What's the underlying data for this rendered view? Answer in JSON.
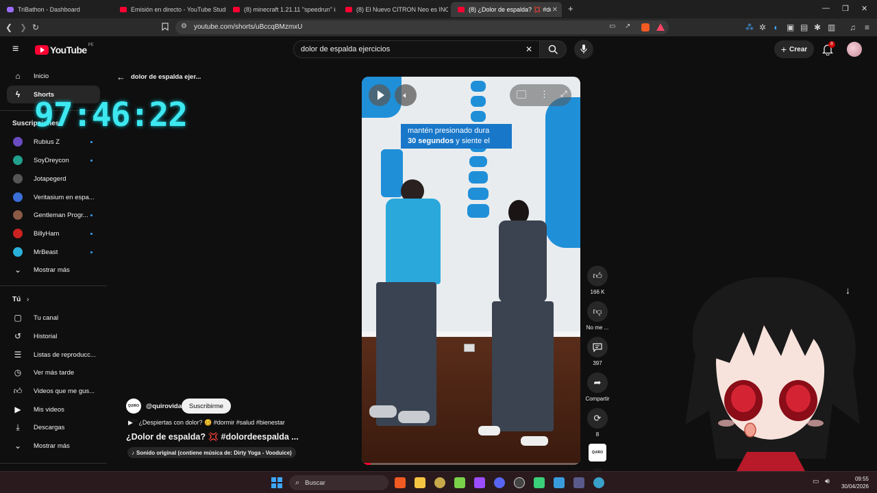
{
  "browser": {
    "tabs": [
      {
        "title": "TriBathon - Dashboard"
      },
      {
        "title": "Emisión en directo - YouTube Studio"
      },
      {
        "title": "(8) minecraft 1.21.11 \"speedrun\" in 2..."
      },
      {
        "title": "(8) El Nuevo CITRON Neo es INCREÍB..."
      },
      {
        "title": "(8) ¿Dolor de espalda? 💢 #dolo..."
      }
    ],
    "url": "youtube.com/shorts/uBccqBMzmxU"
  },
  "yt": {
    "logo_text": "YouTube",
    "logo_region": "PE",
    "search_value": "dolor de espalda ejercicios",
    "create_label": "Crear",
    "notif_count": "8"
  },
  "sidebar": {
    "main": [
      {
        "label": "Inicio",
        "icon": "home-icon"
      },
      {
        "label": "Shorts",
        "icon": "shorts-icon"
      }
    ],
    "subs_header": "Suscripciones",
    "subs": [
      {
        "label": "Rubius Z",
        "color": "#6a4cc2",
        "dot": true
      },
      {
        "label": "SoyDreycon",
        "color": "#21a08c",
        "dot": true
      },
      {
        "label": "Jotapegerd",
        "color": "#555555",
        "dot": false
      },
      {
        "label": "Veritasium en espa...",
        "color": "#3a6fd8",
        "dot": false
      },
      {
        "label": "Gentleman Progr...",
        "color": "#8a5a44",
        "dot": true
      },
      {
        "label": "BillyHam",
        "color": "#cc2222",
        "dot": true
      },
      {
        "label": "MrBeast",
        "color": "#2ab0d8",
        "dot": true
      }
    ],
    "more_subs": "Mostrar más",
    "you_header": "Tú",
    "you": [
      {
        "label": "Tu canal",
        "icon": "channel-icon"
      },
      {
        "label": "Historial",
        "icon": "history-icon"
      },
      {
        "label": "Listas de reproducc...",
        "icon": "playlists-icon"
      },
      {
        "label": "Ver más tarde",
        "icon": "watch-later-icon"
      },
      {
        "label": "Videos que me gus...",
        "icon": "liked-icon"
      },
      {
        "label": "Mis videos",
        "icon": "my-videos-icon"
      },
      {
        "label": "Descargas",
        "icon": "downloads-icon"
      }
    ],
    "more_you": "Mostrar más"
  },
  "timer": "97:46:22",
  "short": {
    "back_label": "dolor de espalda ejer...",
    "caption_line1": "mantén presionado dura",
    "caption_line2_bold": "30 segundos",
    "caption_line2_rest": " y siente el",
    "channel": "@quirovida",
    "channel_logo_text": "QUIRO VIDA",
    "subscribe": "Suscribirme",
    "desc": "¿Despiertas con dolor? 🥴 #dormir #salud #bienestar",
    "title": "¿Dolor de espalda? 💢 #dolordeespalda ...",
    "sound": "Sonido original (contiene música de: Dirty Yoga - Vooduice)",
    "progress": 0.04
  },
  "actions": {
    "likes": "166 K",
    "dislike": "No me ...",
    "comments": "397",
    "share": "Compartir",
    "remix": "8"
  },
  "taskbar": {
    "search": "Buscar",
    "time": "09:55",
    "date": "30/04/2026"
  }
}
